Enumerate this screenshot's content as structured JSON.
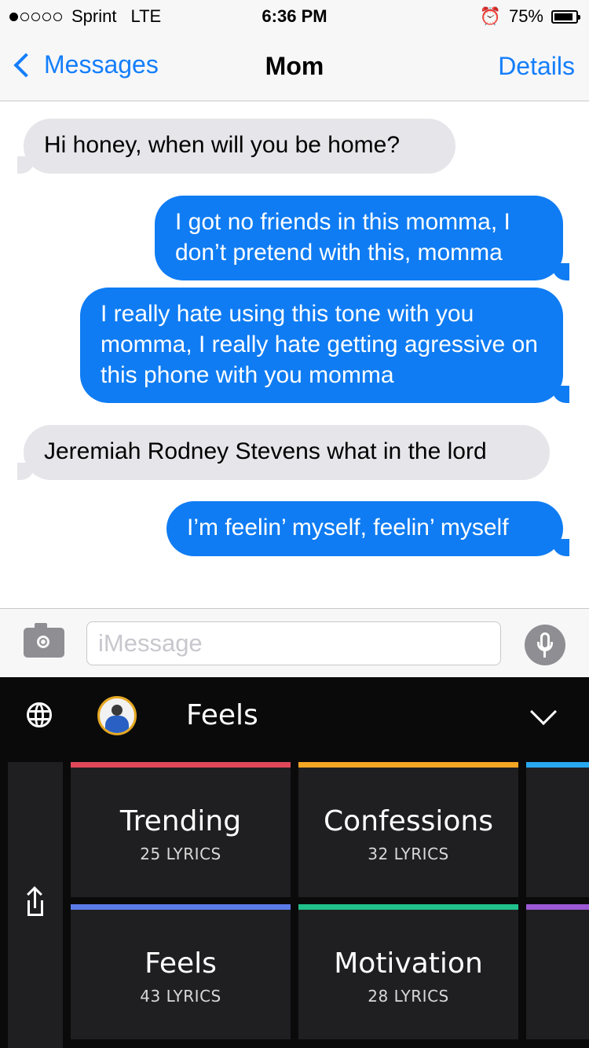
{
  "status_bar": {
    "carrier": "Sprint",
    "network": "LTE",
    "time": "6:36 PM",
    "battery": "75%",
    "battery_level": 0.75,
    "signal_bars_filled": 1
  },
  "nav": {
    "back_label": "Messages",
    "title": "Mom",
    "details_label": "Details"
  },
  "messages": [
    {
      "from": "them",
      "text": "Hi honey, when will you be home?"
    },
    {
      "from": "me",
      "text": "I got no friends in this momma, I don’t pretend with this, momma"
    },
    {
      "from": "me",
      "text": "I really hate using this tone with you momma, I really hate getting agressive on this phone with you momma"
    },
    {
      "from": "them",
      "text": "Jeremiah Rodney Stevens what in the lord"
    },
    {
      "from": "me",
      "text": "I’m feelin’ myself, feelin’ myself"
    }
  ],
  "input": {
    "placeholder": "iMessage",
    "value": ""
  },
  "keyboard": {
    "title": "Feels",
    "categories": [
      {
        "name": "Trending",
        "count": "25 LYRICS",
        "color": "#e0485a"
      },
      {
        "name": "Confessions",
        "count": "32 LYRICS",
        "color": "#f5a623"
      },
      {
        "name": "Feels",
        "count": "43 LYRICS",
        "color": "#5b7be8"
      },
      {
        "name": "Motivation",
        "count": "28 LYRICS",
        "color": "#21c08b"
      }
    ],
    "partial_colors": [
      "#29a8f0",
      "#9b59d6"
    ]
  },
  "colors": {
    "ios_blue": "#147efb",
    "sent_bubble": "#0f7cf3",
    "recv_bubble": "#e5e5ea",
    "keyboard_bg": "#0a0a0b"
  }
}
